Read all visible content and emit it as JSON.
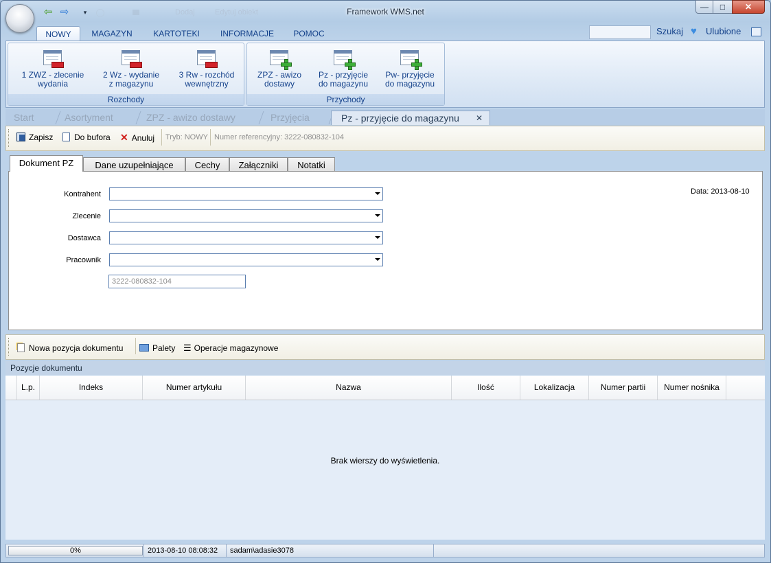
{
  "window": {
    "title": "Framework WMS.net",
    "min_label": "—",
    "max_label": "□",
    "close_label": "✕"
  },
  "quick_access": {
    "faded_item1": "Dodaj",
    "faded_item2": "Edytuj obiekt"
  },
  "menu": {
    "tabs": [
      "NOWY",
      "MAGAZYN",
      "KARTOTEKI",
      "INFORMACJE",
      "POMOC"
    ],
    "active": "NOWY",
    "search_label": "Szukaj",
    "favorites_label": "Ulubione"
  },
  "ribbon": {
    "rozchody": {
      "title": "Rozchody",
      "buttons": [
        {
          "line1": "1 ZWZ - zlecenie",
          "line2": "wydania"
        },
        {
          "line1": "2 Wz - wydanie",
          "line2": "z magazynu"
        },
        {
          "line1": "3 Rw - rozchód",
          "line2": "wewnętrzny"
        }
      ]
    },
    "przychody": {
      "title": "Przychody",
      "buttons": [
        {
          "line1": "ZPZ - awizo",
          "line2": "dostawy"
        },
        {
          "line1": "Pz - przyjęcie",
          "line2": "do magazynu"
        },
        {
          "line1": "Pw- przyjęcie",
          "line2": "do magazynu"
        }
      ]
    }
  },
  "doc_tabs": {
    "items": [
      "Start",
      "Asortyment",
      "ZPZ - awizo dostawy",
      "Przyjęcia",
      "Pz - przyjęcie do magazynu"
    ],
    "active": "Pz - przyjęcie do magazynu",
    "close": "✕"
  },
  "toolbar": {
    "save": "Zapisz",
    "to_buffer": "Do bufora",
    "cancel": "Anuluj",
    "mode": "Tryb: NOWY",
    "reference": "Numer referencyjny: 3222-080832-104"
  },
  "form_tabs": [
    "Dokument PZ",
    "Dane uzupełniające",
    "Cechy",
    "Załączniki",
    "Notatki"
  ],
  "form": {
    "date": "Data: 2013-08-10",
    "fields": [
      {
        "label": "Kontrahent",
        "value": ""
      },
      {
        "label": "Zlecenie",
        "value": ""
      },
      {
        "label": "Dostawca",
        "value": ""
      },
      {
        "label": "Pracownik",
        "value": ""
      }
    ],
    "reference_value": "3222-080832-104"
  },
  "positions_toolbar": {
    "new_position": "Nowa pozycja dokumentu",
    "pallets": "Palety",
    "operations": "Operacje magazynowe"
  },
  "grid": {
    "title": "Pozycje dokumentu",
    "columns": [
      "L.p.",
      "Indeks",
      "Numer artykułu",
      "Nazwa",
      "Ilość",
      "Lokalizacja",
      "Numer partii",
      "Numer nośnika"
    ],
    "rows": [],
    "empty_message": "Brak wierszy do wyświetlenia."
  },
  "status": {
    "progress_value": 0,
    "progress_text": "0%",
    "datetime": "2013-08-10 08:08:32",
    "user": "sadam\\adasie3078"
  }
}
